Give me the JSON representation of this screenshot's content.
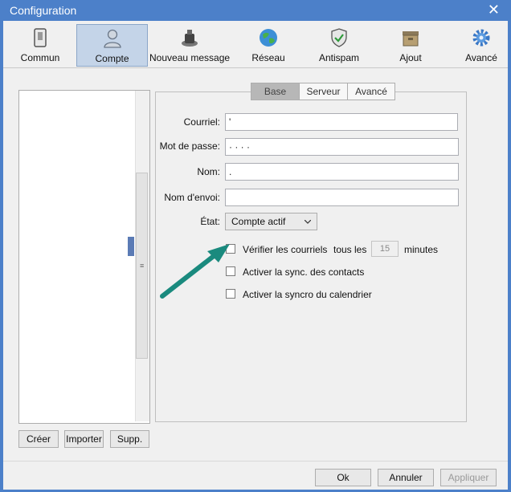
{
  "window": {
    "title": "Configuration"
  },
  "toolbar": {
    "items": [
      {
        "label": "Commun",
        "icon": "device-icon"
      },
      {
        "label": "Compte",
        "icon": "user-icon"
      },
      {
        "label": "Nouveau message",
        "icon": "inkwell-icon"
      },
      {
        "label": "Réseau",
        "icon": "globe-icon"
      },
      {
        "label": "Antispam",
        "icon": "shield-icon"
      },
      {
        "label": "Ajout",
        "icon": "box-icon"
      },
      {
        "label": "Avancé",
        "icon": "gear-icon"
      }
    ],
    "selected": "Compte"
  },
  "accounts": {
    "buttons": {
      "create": "Créer",
      "import": "Importer",
      "delete": "Supp."
    }
  },
  "tabs": {
    "base": "Base",
    "server": "Serveur",
    "advanced": "Avancé",
    "selected": "Base"
  },
  "form": {
    "email_label": "Courriel:",
    "email_value": "'",
    "password_label": "Mot de passe:",
    "password_value": "· · · ·",
    "name_label": "Nom:",
    "name_value": ".",
    "sender_label": "Nom d'envoi:",
    "sender_value": "",
    "state_label": "État:",
    "state_value": "Compte actif"
  },
  "options": {
    "check_mail_label": "Vérifier les courriels",
    "every_label": "tous les",
    "interval_value": "15",
    "minutes_label": "minutes",
    "check_mail_checked": false,
    "sync_contacts_label": "Activer la sync. des contacts",
    "sync_contacts_checked": false,
    "sync_calendar_label": "Activer la syncro du calendrier",
    "sync_calendar_checked": false
  },
  "footer": {
    "ok": "Ok",
    "cancel": "Annuler",
    "apply": "Appliquer"
  },
  "colors": {
    "titlebar": "#4c80c9",
    "annotation_arrow": "#1a8a7e",
    "selected_tool": "#c4d4e8"
  }
}
